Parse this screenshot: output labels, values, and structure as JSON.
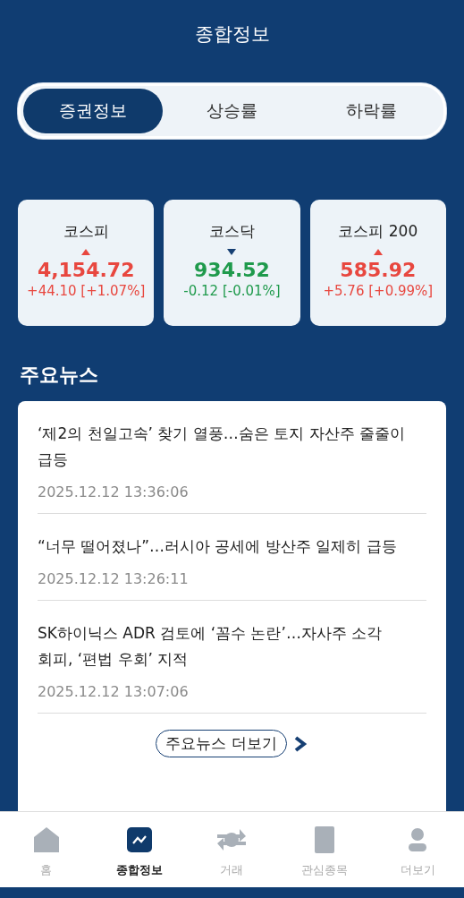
{
  "header": {
    "title": "종합정보"
  },
  "tabs": [
    {
      "label": "증권정보",
      "selected": true
    },
    {
      "label": "상승률",
      "selected": false
    },
    {
      "label": "하락률",
      "selected": false
    }
  ],
  "indices": [
    {
      "name": "코스피",
      "kind": "up",
      "value": "4,154.72",
      "change": "+44.10 [+1.07%]"
    },
    {
      "name": "코스닥",
      "kind": "down",
      "value": "934.52",
      "change": "-0.12 [-0.01%]"
    },
    {
      "name": "코스피 200",
      "kind": "up",
      "value": "585.92",
      "change": "+5.76 [+0.99%]"
    }
  ],
  "news": {
    "title": "주요뉴스",
    "items": [
      {
        "headline": "‘제2의 천일고속’ 찾기 열풍…숨은 토지 자산주 줄줄이 급등",
        "time": "2025.12.12 13:36:06"
      },
      {
        "headline": "“너무 떨어졌나”…러시아 공세에 방산주 일제히 급등",
        "time": "2025.12.12 13:26:11"
      },
      {
        "headline": "SK하이닉스 ADR 검토에 ‘꼼수 논란’…자사주 소각 회피, ‘편법 우회’ 지적",
        "time": "2025.12.12 13:07:06"
      }
    ],
    "more_button": "주요뉴스 더보기"
  },
  "bottom_nav": [
    {
      "label": "홈",
      "kind": "home",
      "selected": false
    },
    {
      "label": "종합정보",
      "kind": "chart",
      "selected": true
    },
    {
      "label": "거래",
      "kind": "exchange",
      "selected": false
    },
    {
      "label": "관심종목",
      "kind": "bookmark",
      "selected": false
    },
    {
      "label": "더보기",
      "kind": "profile",
      "selected": false
    }
  ]
}
